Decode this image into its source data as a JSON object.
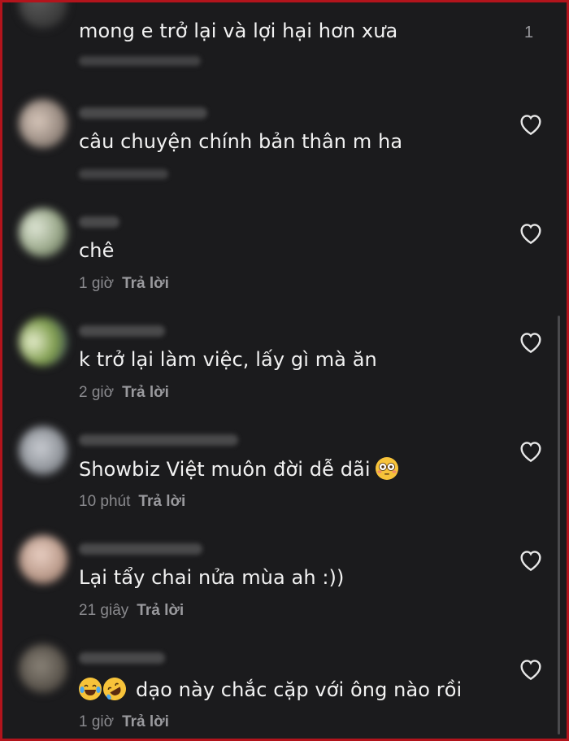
{
  "comments": [
    {
      "text": "mong e trở lại và lợi hại hơn xưa",
      "like_count": "1"
    },
    {
      "text": "câu chuyện chính bản thân m ha"
    },
    {
      "text": "chê",
      "time": "1 giờ",
      "reply": "Trả lời"
    },
    {
      "text": "k trở lại làm việc, lấy gì mà ăn",
      "time": "2 giờ",
      "reply": "Trả lời"
    },
    {
      "text": "Showbiz Việt muôn đời dễ dãi",
      "time": "10 phút",
      "reply": "Trả lời"
    },
    {
      "text": "Lại tẩy chai nửa mùa ah :))",
      "time": "21 giây",
      "reply": "Trả lời"
    },
    {
      "text": "dạo này chắc cặp với ông nào rồi",
      "time": "1 giờ",
      "reply": "Trả lời"
    }
  ],
  "icons": {
    "like": "heart-outline-icon",
    "flushed": "flushed-face-emoji",
    "laughing": "tears-of-joy-emoji",
    "rofl": "rolling-laughing-emoji"
  },
  "colors": {
    "background": "#1b1b1d",
    "border": "#b3141c",
    "text": "#f2f2f2",
    "meta": "#8a8a8e"
  }
}
